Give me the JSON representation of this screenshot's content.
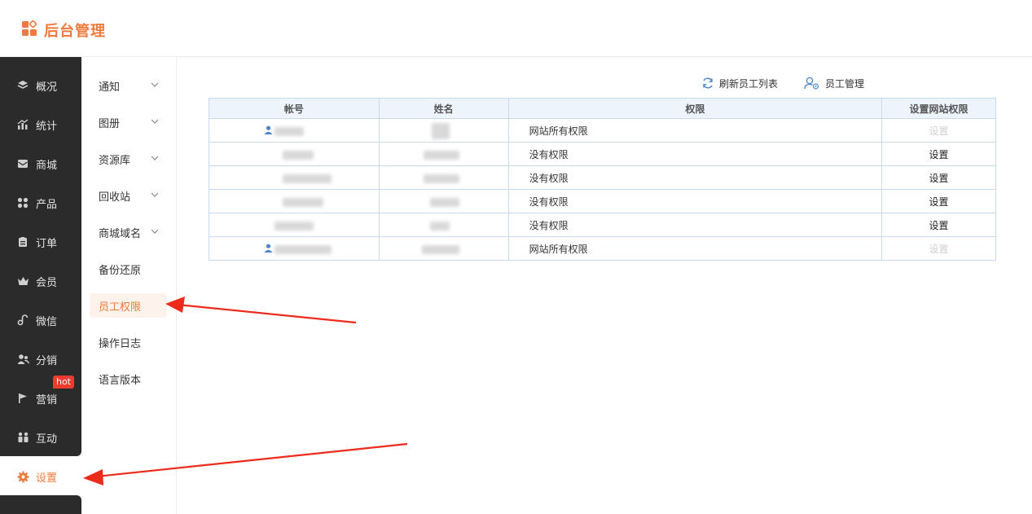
{
  "app": {
    "title": "后台管理"
  },
  "sidebar": {
    "items": [
      {
        "label": "概况",
        "icon": "layers-icon"
      },
      {
        "label": "统计",
        "icon": "chart-icon"
      },
      {
        "label": "商城",
        "icon": "mail-icon"
      },
      {
        "label": "产品",
        "icon": "grid-icon"
      },
      {
        "label": "订单",
        "icon": "clipboard-icon"
      },
      {
        "label": "会员",
        "icon": "crown-icon"
      },
      {
        "label": "微信",
        "icon": "link-icon"
      },
      {
        "label": "分销",
        "icon": "users-icon"
      },
      {
        "label": "营销",
        "icon": "flag-icon",
        "badge": "hot"
      },
      {
        "label": "互动",
        "icon": "people-icon"
      },
      {
        "label": "设置",
        "icon": "gear-icon",
        "active": true
      }
    ]
  },
  "submenu": {
    "items": [
      {
        "label": "通知",
        "expandable": true
      },
      {
        "label": "图册",
        "expandable": true
      },
      {
        "label": "资源库",
        "expandable": true
      },
      {
        "label": "回收站",
        "expandable": true
      },
      {
        "label": "商城域名",
        "expandable": true
      },
      {
        "label": "备份还原",
        "expandable": false
      },
      {
        "label": "员工权限",
        "expandable": false,
        "active": true
      },
      {
        "label": "操作日志",
        "expandable": false
      },
      {
        "label": "语言版本",
        "expandable": false
      }
    ]
  },
  "toolbar": {
    "refresh_label": "刷新员工列表",
    "manage_label": "员工管理"
  },
  "table": {
    "headers": [
      "帐号",
      "姓名",
      "权限",
      "设置网站权限"
    ],
    "rows": [
      {
        "permission": "网站所有权限",
        "action": "设置",
        "action_enabled": false
      },
      {
        "permission": "没有权限",
        "action": "设置",
        "action_enabled": true
      },
      {
        "permission": "没有权限",
        "action": "设置",
        "action_enabled": true
      },
      {
        "permission": "没有权限",
        "action": "设置",
        "action_enabled": true
      },
      {
        "permission": "没有权限",
        "action": "设置",
        "action_enabled": true
      },
      {
        "permission": "网站所有权限",
        "action": "设置",
        "action_enabled": false
      }
    ]
  },
  "colors": {
    "accent": "#f07a3d",
    "sidebar_bg": "#2b2b2b",
    "table_header_bg": "#eef4fb",
    "table_border": "#c9d9ee",
    "annotation_arrow": "#ee2a1b",
    "hot_badge": "#ee3b2f"
  }
}
